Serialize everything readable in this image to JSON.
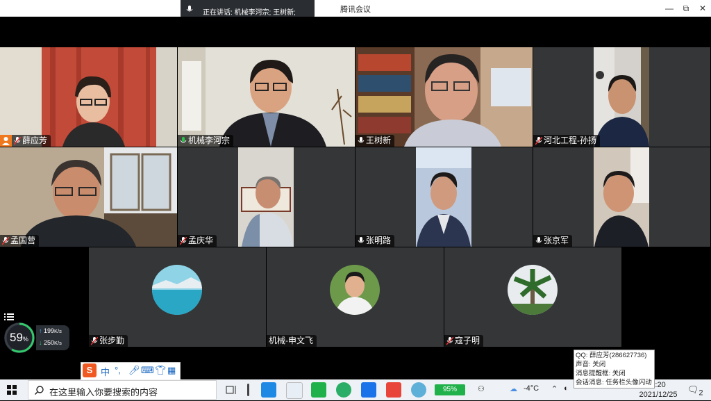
{
  "window": {
    "title": "腾讯会议",
    "speaking": "正在讲话: 机械李河宗; 王树新;"
  },
  "window_controls": {
    "minimize": "—",
    "restore": "⧉",
    "close": "✕"
  },
  "participants": [
    {
      "name": "薛应芳",
      "mic": "muted",
      "video": "on",
      "host": true
    },
    {
      "name": "机械李河宗",
      "mic": "on",
      "video": "on",
      "speaking": true
    },
    {
      "name": "王树新",
      "mic": "on",
      "video": "on"
    },
    {
      "name": "河北工程-孙扬",
      "mic": "muted",
      "video": "on"
    },
    {
      "name": "孟国营",
      "mic": "muted",
      "video": "on"
    },
    {
      "name": "孟庆华",
      "mic": "muted",
      "video": "on"
    },
    {
      "name": "张明路",
      "mic": "on",
      "video": "on"
    },
    {
      "name": "张京军",
      "mic": "on",
      "video": "on"
    },
    {
      "name": "张步勤",
      "mic": "muted",
      "video": "off"
    },
    {
      "name": "机械-申文飞",
      "mic": "none",
      "video": "off"
    },
    {
      "name": "寇子明",
      "mic": "muted",
      "video": "off"
    }
  ],
  "network": {
    "percent": "59",
    "percent_unit": "%",
    "percent_value": 59,
    "upload": "199",
    "download": "250",
    "unit": "K/s"
  },
  "ime": {
    "logo": "S",
    "mode": "中",
    "punct": "°,"
  },
  "qq_notice": {
    "line1": "QQ: 薛应芳(286627736)",
    "line2": "声音: 关闭",
    "line3": "消息提醒框: 关闭",
    "line4": "会话消息: 任务栏头像闪动"
  },
  "taskbar": {
    "search_placeholder": "在这里输入你要搜索的内容",
    "battery": "95%",
    "weather": "-4°C",
    "time": "0:20",
    "date": "2021/12/25",
    "notifications": "2"
  },
  "colors": {
    "accent": "#27c24c",
    "host_badge": "#f0781e",
    "tile_bg": "#343638"
  }
}
